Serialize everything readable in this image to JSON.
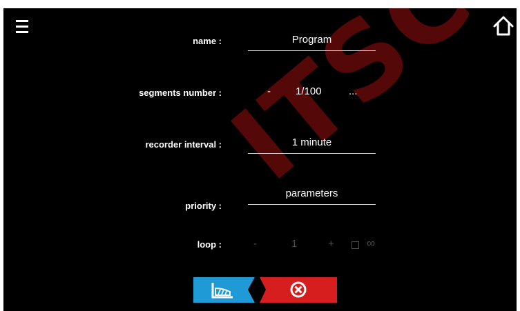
{
  "form": {
    "name_label": "name :",
    "name_value": "Program",
    "segments_label": "segments number :",
    "segments_minus": "-",
    "segments_value": "1/100",
    "segments_more": "...",
    "interval_label": "recorder interval :",
    "interval_value": "1 minute",
    "priority_label": "priority :",
    "priority_value": "parameters",
    "loop_label": "loop :",
    "loop_minus": "-",
    "loop_value": "1",
    "loop_plus": "+",
    "loop_infinite": "∞"
  },
  "icons": {
    "menu": "hamburger-menu-icon",
    "home": "home-icon",
    "chart": "chart-icon",
    "close": "close-circle-icon"
  },
  "watermark": {
    "text": "ITSCHE"
  },
  "colors": {
    "background": "#000000",
    "text": "#ffffff",
    "disabled": "#4f4f4f",
    "accent_blue": "#1f9ad6",
    "accent_red": "#d61e1e"
  }
}
